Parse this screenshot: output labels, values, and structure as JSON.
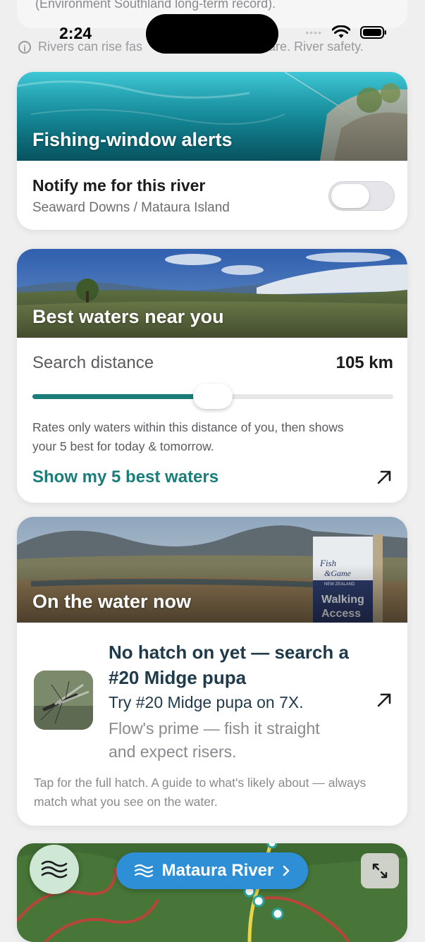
{
  "top_card": {
    "note": "(Environment Southland long-term record)."
  },
  "status_bar": {
    "time": "2:24"
  },
  "safety": {
    "text_left": "Rivers can rise fas",
    "text_right": "care. River safety."
  },
  "alerts_card": {
    "title": "Fishing-window alerts",
    "notify_label": "Notify me for this river",
    "location": "Seaward Downs / Mataura Island",
    "toggle_on": false
  },
  "best_waters_card": {
    "title": "Best waters near you",
    "search_label": "Search distance",
    "search_value": "105 km",
    "slider_fraction": 0.5,
    "help_text": "Rates only waters within this distance of you, then shows your 5 best for today & tomorrow.",
    "action_label": "Show my 5 best waters"
  },
  "on_water_card": {
    "title": "On the water now",
    "hatch_title": "No hatch on yet — search a #20 Midge pupa",
    "try_text": "Try #20 Midge pupa on 7X.",
    "flow_text": "Flow's prime — fish it straight and expect risers.",
    "sign_text": [
      "Fish",
      "&Game",
      "NEW ZEALAND",
      "Walking",
      "Access"
    ],
    "footer_text": "Tap for the full hatch. A guide to what's likely about — always match what you see on the water."
  },
  "map_card": {
    "river_name": "Mataura River"
  },
  "colors": {
    "accent_teal": "#1a7d7a",
    "river_pill_blue": "#2e8fd6",
    "hatch_title_navy": "#1f3a4a"
  },
  "icons": [
    "info-icon",
    "wifi-icon",
    "battery-icon",
    "arrow-up-right-icon",
    "waves-icon",
    "chevron-right-icon",
    "expand-icon"
  ]
}
